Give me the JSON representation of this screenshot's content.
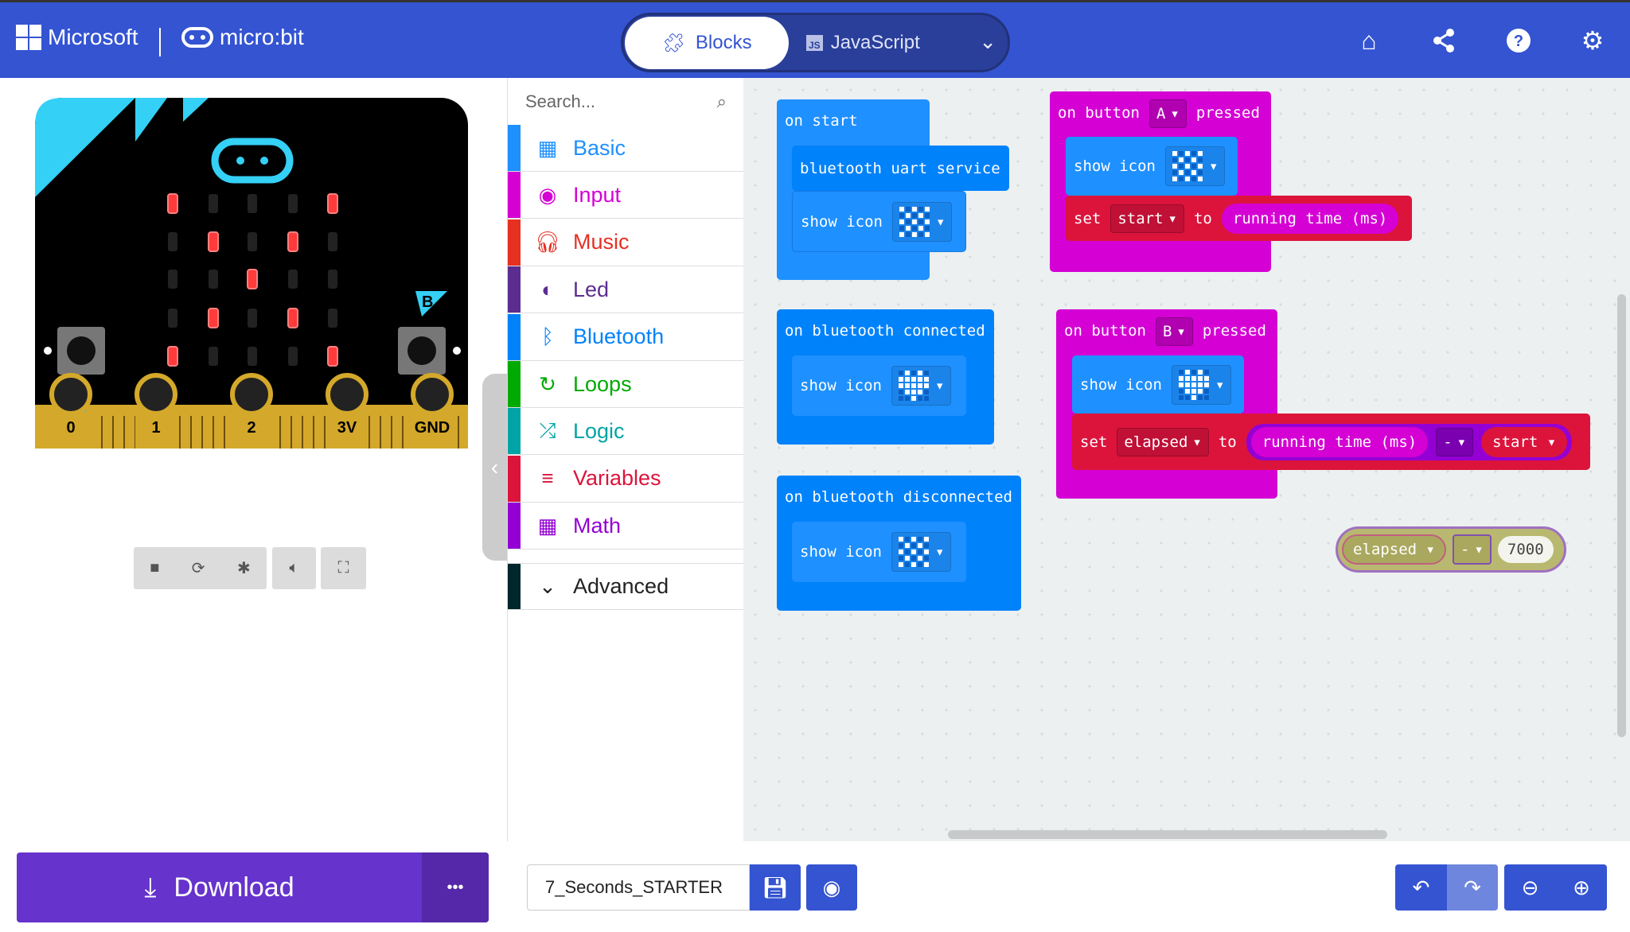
{
  "header": {
    "brand": "Microsoft",
    "product": "micro:bit",
    "tabs": [
      {
        "label": "Blocks",
        "active": true
      },
      {
        "label": "JavaScript",
        "active": false
      }
    ],
    "js_badge": "JS",
    "icons": [
      "home-icon",
      "share-icon",
      "help-icon",
      "gear-icon"
    ],
    "color": "#3454d1"
  },
  "simulator": {
    "leds": [
      [
        1,
        0,
        0,
        0,
        1
      ],
      [
        0,
        1,
        0,
        1,
        0
      ],
      [
        0,
        0,
        1,
        0,
        0
      ],
      [
        0,
        1,
        0,
        1,
        0
      ],
      [
        1,
        0,
        0,
        0,
        1
      ]
    ],
    "pins": [
      "0",
      "1",
      "2",
      "3V",
      "GND"
    ],
    "button_a": "A",
    "button_b": "B"
  },
  "toolbox": {
    "search_placeholder": "Search...",
    "categories": [
      {
        "label": "Basic",
        "color": "#1e90ff",
        "icon": "grid-icon"
      },
      {
        "label": "Input",
        "color": "#d400d4",
        "icon": "target-icon"
      },
      {
        "label": "Music",
        "color": "#e63022",
        "icon": "headphones-icon"
      },
      {
        "label": "Led",
        "color": "#5c2d91",
        "icon": "toggle-icon"
      },
      {
        "label": "Bluetooth",
        "color": "#0082fb",
        "icon": "bluetooth-icon"
      },
      {
        "label": "Loops",
        "color": "#00aa00",
        "icon": "refresh-icon"
      },
      {
        "label": "Logic",
        "color": "#00a4a6",
        "icon": "shuffle-icon"
      },
      {
        "label": "Variables",
        "color": "#dc143c",
        "icon": "list-icon"
      },
      {
        "label": "Math",
        "color": "#9400d3",
        "icon": "calculator-icon"
      }
    ],
    "advanced": "Advanced"
  },
  "blocks": {
    "on_start": "on start",
    "uart": "bluetooth uart service",
    "show_icon": "show icon",
    "on_button": "on button",
    "pressed": "pressed",
    "button_a": "A",
    "button_b": "B",
    "set": "set",
    "to": "to",
    "var_start": "start",
    "var_elapsed": "elapsed",
    "running_time": "running time (ms)",
    "minus": "-",
    "on_connected": "on bluetooth connected",
    "on_disconnected": "on bluetooth disconnected",
    "number": "7000",
    "icons": {
      "x": [
        [
          1,
          0,
          0,
          0,
          1
        ],
        [
          0,
          1,
          0,
          1,
          0
        ],
        [
          0,
          0,
          1,
          0,
          0
        ],
        [
          0,
          1,
          0,
          1,
          0
        ],
        [
          1,
          0,
          0,
          0,
          1
        ]
      ],
      "heart": [
        [
          0,
          1,
          0,
          1,
          0
        ],
        [
          1,
          1,
          1,
          1,
          1
        ],
        [
          1,
          1,
          1,
          1,
          1
        ],
        [
          0,
          1,
          1,
          1,
          0
        ],
        [
          0,
          0,
          1,
          0,
          0
        ]
      ],
      "check": [
        [
          1,
          0,
          1,
          0,
          1
        ],
        [
          0,
          1,
          0,
          1,
          0
        ],
        [
          1,
          0,
          1,
          0,
          1
        ],
        [
          0,
          1,
          0,
          1,
          0
        ],
        [
          1,
          0,
          1,
          0,
          1
        ]
      ]
    }
  },
  "footer": {
    "download": "Download",
    "more": "•••",
    "project_name": "7_Seconds_STARTER"
  }
}
